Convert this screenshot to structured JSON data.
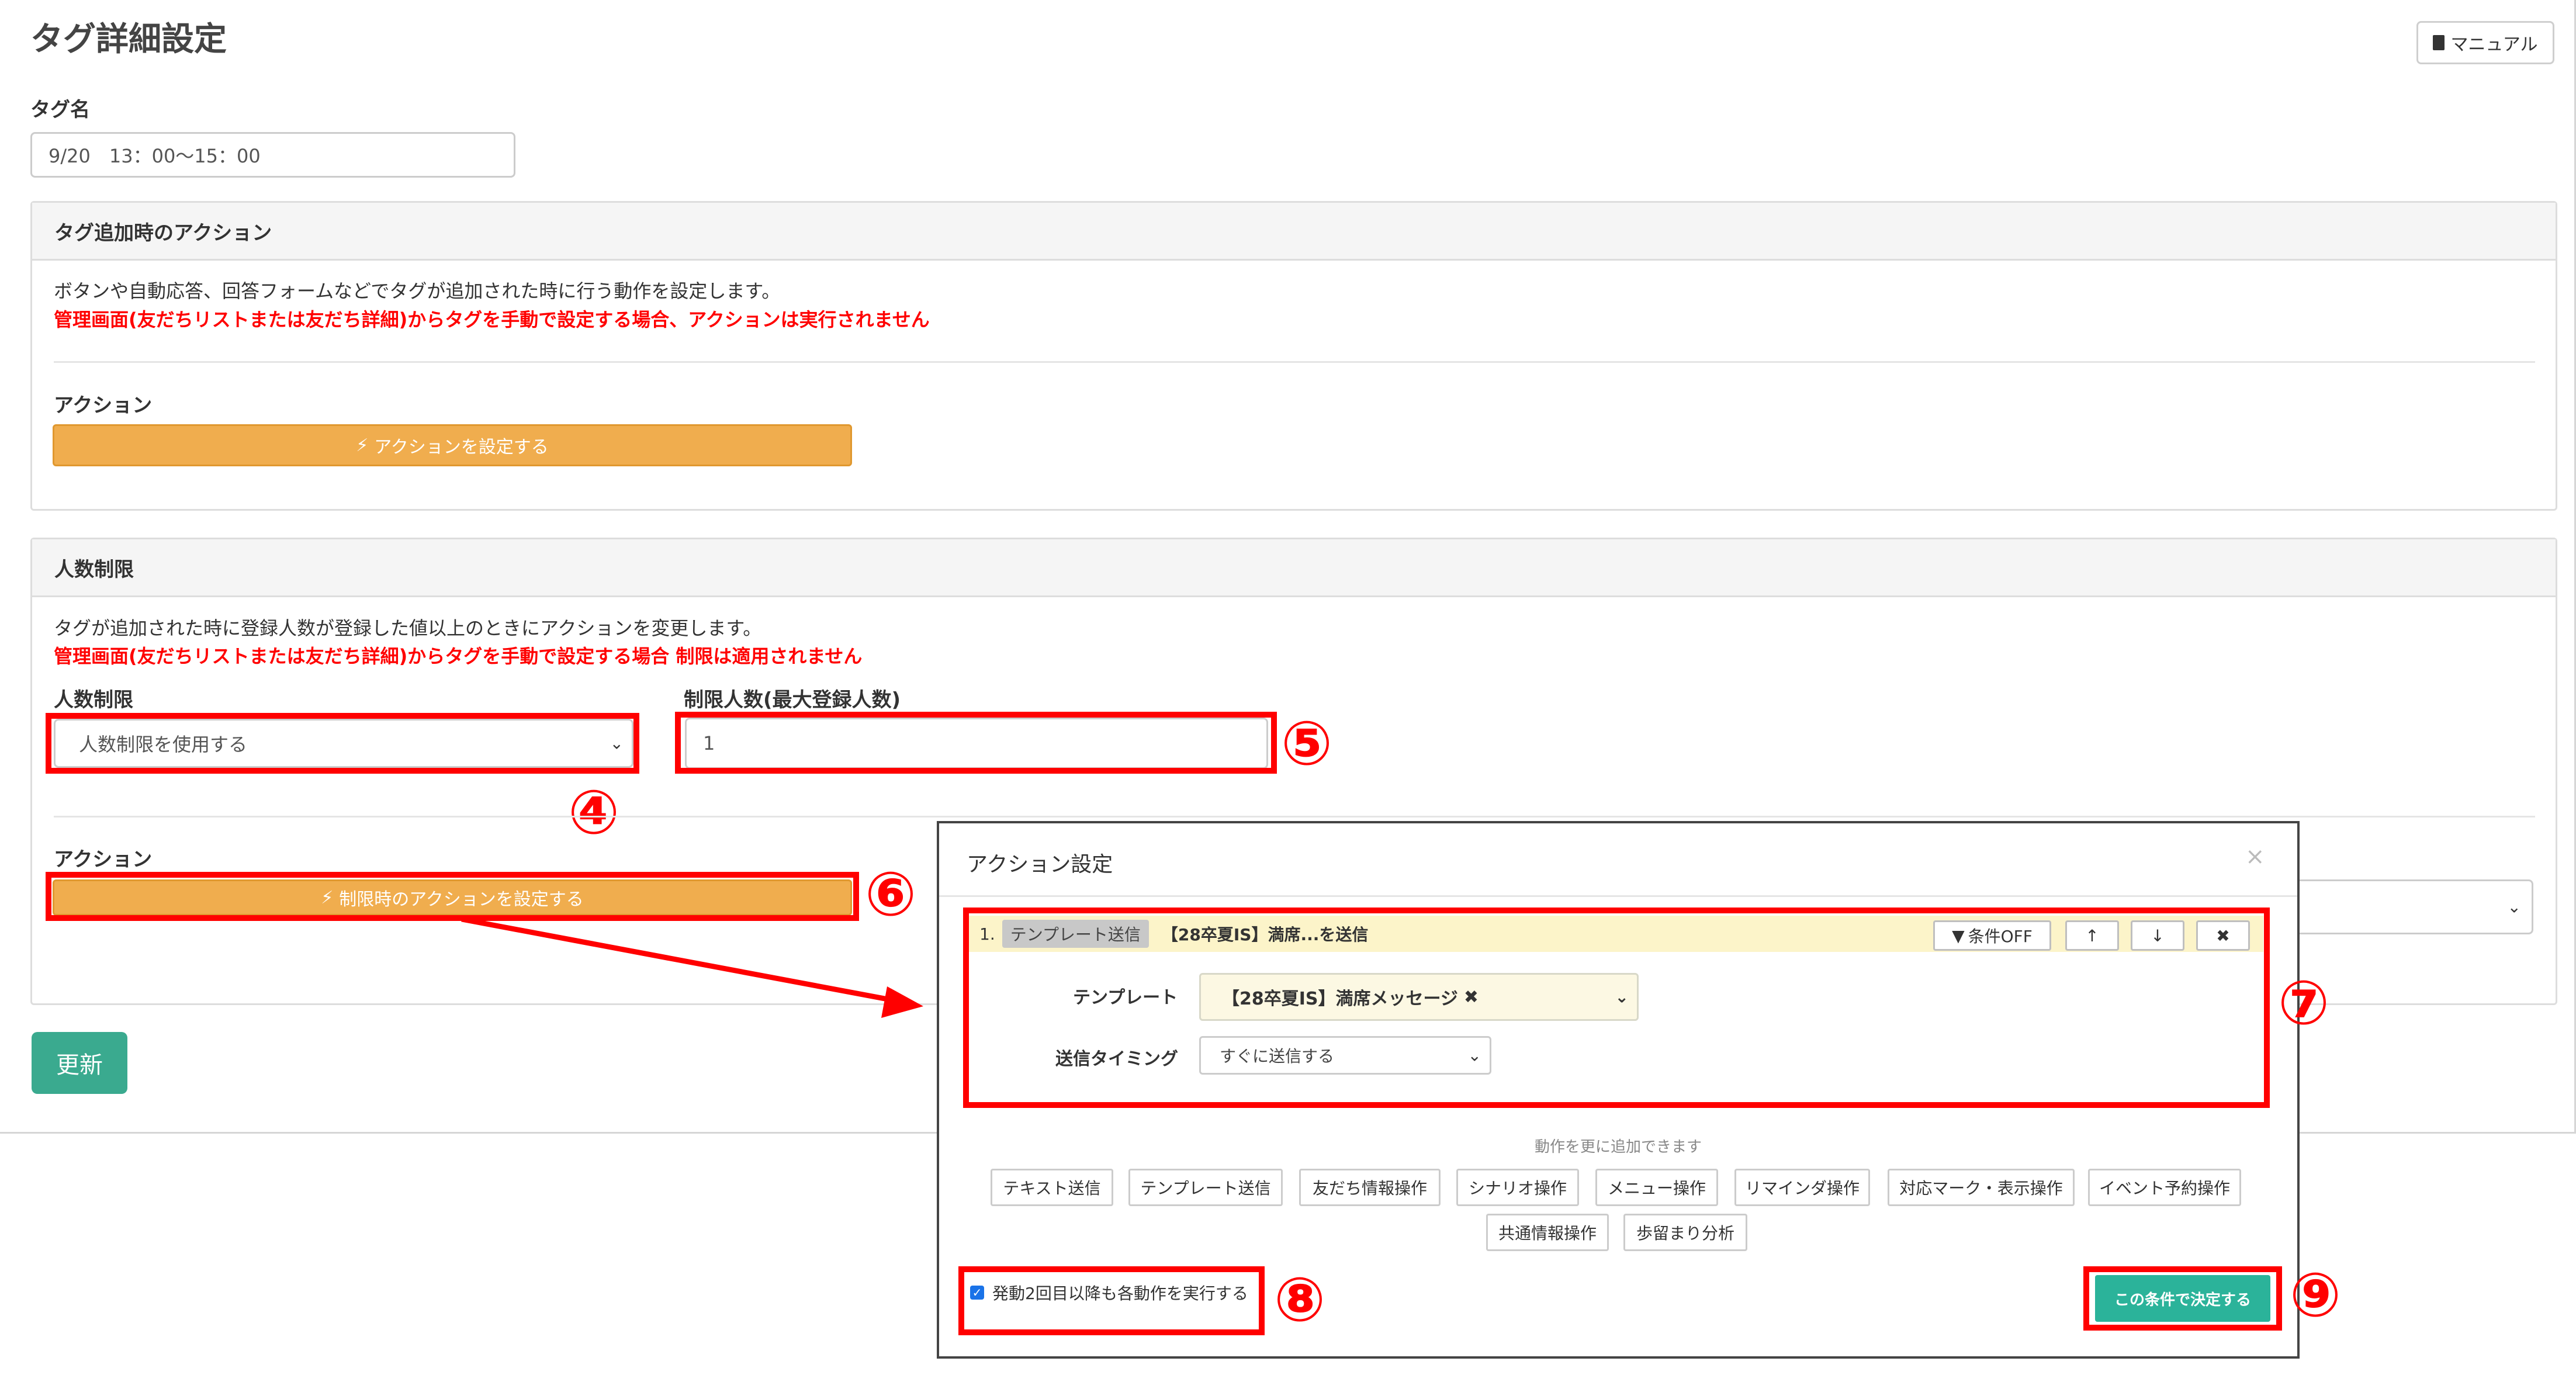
{
  "page": {
    "title": "タグ詳細設定",
    "manual_label": "マニュアル"
  },
  "tag_name": {
    "label": "タグ名",
    "value": "9/20　13：00～15：00"
  },
  "tag_action_panel": {
    "heading": "タグ追加時のアクション",
    "description": "ボタンや自動応答、回答フォームなどでタグが追加された時に行う動作を設定します。",
    "warning": "管理画面(友だちリストまたは友だち詳細)からタグを手動で設定する場合、アクションは実行されません",
    "action_label": "アクション",
    "action_button": "アクションを設定する"
  },
  "limit_panel": {
    "heading": "人数制限",
    "description": "タグが追加された時に登録人数が登録した値以上のときにアクションを変更します。",
    "warning": "管理画面(友だちリストまたは友だち詳細)からタグを手動で設定する場合 制限は適用されません",
    "limit_label": "人数制限",
    "limit_select": "人数制限を使用する",
    "max_label": "制限人数(最大登録人数)",
    "max_value": "1",
    "action_label": "アクション",
    "action_button": "制限時のアクションを設定する"
  },
  "update_button": "更新",
  "modal": {
    "title": "アクション設定",
    "close": "×",
    "row": {
      "number": "1.",
      "badge": "テンプレート送信",
      "text": "【28卒夏IS】満席...を送信",
      "cond_btn": "条件OFF",
      "up": "↑",
      "down": "↓",
      "delete": "✖"
    },
    "template_label": "テンプレート",
    "template_value": "【28卒夏IS】満席メッセージ",
    "template_clear": "✖",
    "timing_label": "送信タイミング",
    "timing_value": "すぐに送信する",
    "hint": "動作を更に追加できます",
    "chips": [
      "テキスト送信",
      "テンプレート送信",
      "友だち情報操作",
      "シナリオ操作",
      "メニュー操作",
      "リマインダ操作",
      "対応マーク・表示操作",
      "イベント予約操作",
      "共通情報操作",
      "歩留まり分析"
    ],
    "checkbox_label": "発動2回目以降も各動作を実行する",
    "confirm_button": "この条件で決定する"
  },
  "annotations": {
    "n4": "④",
    "n5": "⑤",
    "n6": "⑥",
    "n7": "⑦",
    "n8": "⑧",
    "n9": "⑨"
  },
  "colors": {
    "accent_orange": "#f0ad4e",
    "update_green": "#3aaa8f",
    "confirm_green": "#2bb39a",
    "annotation_red": "#ff0000",
    "warning_red": "#ff0000"
  }
}
